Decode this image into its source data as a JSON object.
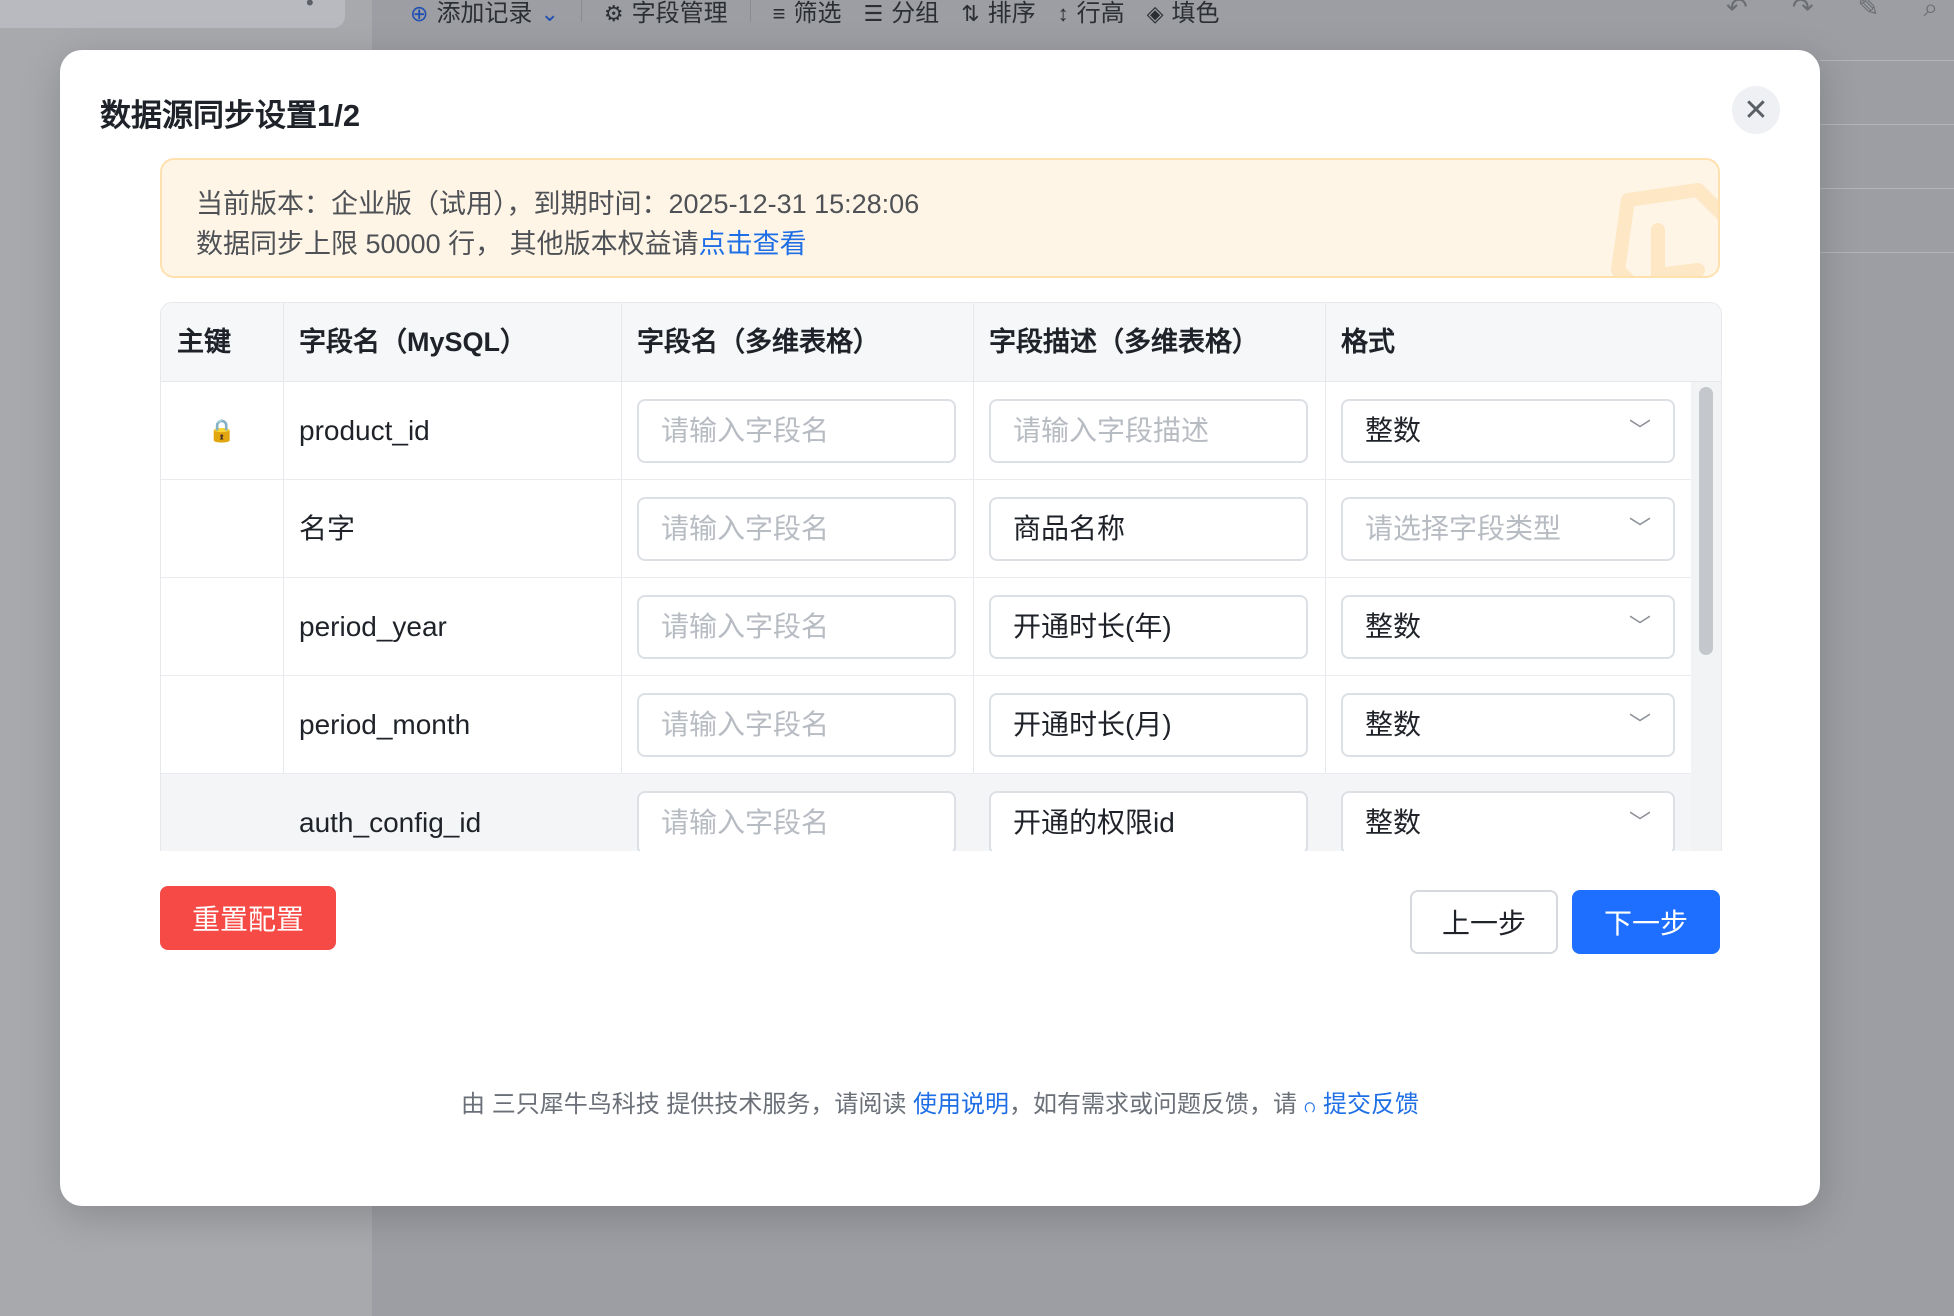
{
  "background": {
    "toolbar": [
      {
        "icon": "⊕",
        "label": "添加记录",
        "caret": "⌄",
        "primary": true
      },
      {
        "icon": "⚙",
        "label": "字段管理"
      },
      {
        "icon": "≡",
        "label": "筛选"
      },
      {
        "icon": "☰",
        "label": "分组"
      },
      {
        "icon": "⇅",
        "label": "排序"
      },
      {
        "icon": "↕",
        "label": "行高"
      },
      {
        "icon": "◈",
        "label": "填色"
      }
    ],
    "dots": "•"
  },
  "modal": {
    "title": "数据源同步设置1/2",
    "close": "✕"
  },
  "notice": {
    "line1": "当前版本：企业版（试用），到期时间：2025-12-31 15:28:06",
    "line2_prefix": "数据同步上限 50000 行，  其他版本权益请",
    "line2_link": "点击查看"
  },
  "table": {
    "headers": {
      "key": "主键",
      "mysql": "字段名（MySQL）",
      "name": "字段名（多维表格）",
      "desc": "字段描述（多维表格）",
      "format": "格式"
    },
    "name_placeholder": "请输入字段名",
    "desc_placeholder": "请输入字段描述",
    "format_placeholder": "请选择字段类型",
    "rows": [
      {
        "primary": true,
        "lock_icon": "🔒",
        "mysql": "product_id",
        "name": "",
        "desc": "",
        "format": "整数"
      },
      {
        "primary": false,
        "mysql": "名字",
        "name": "",
        "desc": "商品名称",
        "format": ""
      },
      {
        "primary": false,
        "mysql": "period_year",
        "name": "",
        "desc": "开通时长(年)",
        "format": "整数"
      },
      {
        "primary": false,
        "mysql": "period_month",
        "name": "",
        "desc": "开通时长(月)",
        "format": "整数"
      },
      {
        "primary": false,
        "mysql": "auth_config_id",
        "name": "",
        "desc": "开通的权限id",
        "format": "整数"
      }
    ]
  },
  "buttons": {
    "reset": "重置配置",
    "prev": "上一步",
    "next": "下一步"
  },
  "footer": {
    "text1": "由 三只犀牛鸟科技 提供技术服务，请阅读 ",
    "link1": "使用说明",
    "text2": "，如有需求或问题反馈，请 ",
    "headset_icon": "ဂ",
    "link2": "提交反馈"
  },
  "colors": {
    "accent": "#1e6fff",
    "danger": "#f54a45",
    "notice_bg": "#fff5e6",
    "link": "#1e6fe6"
  }
}
